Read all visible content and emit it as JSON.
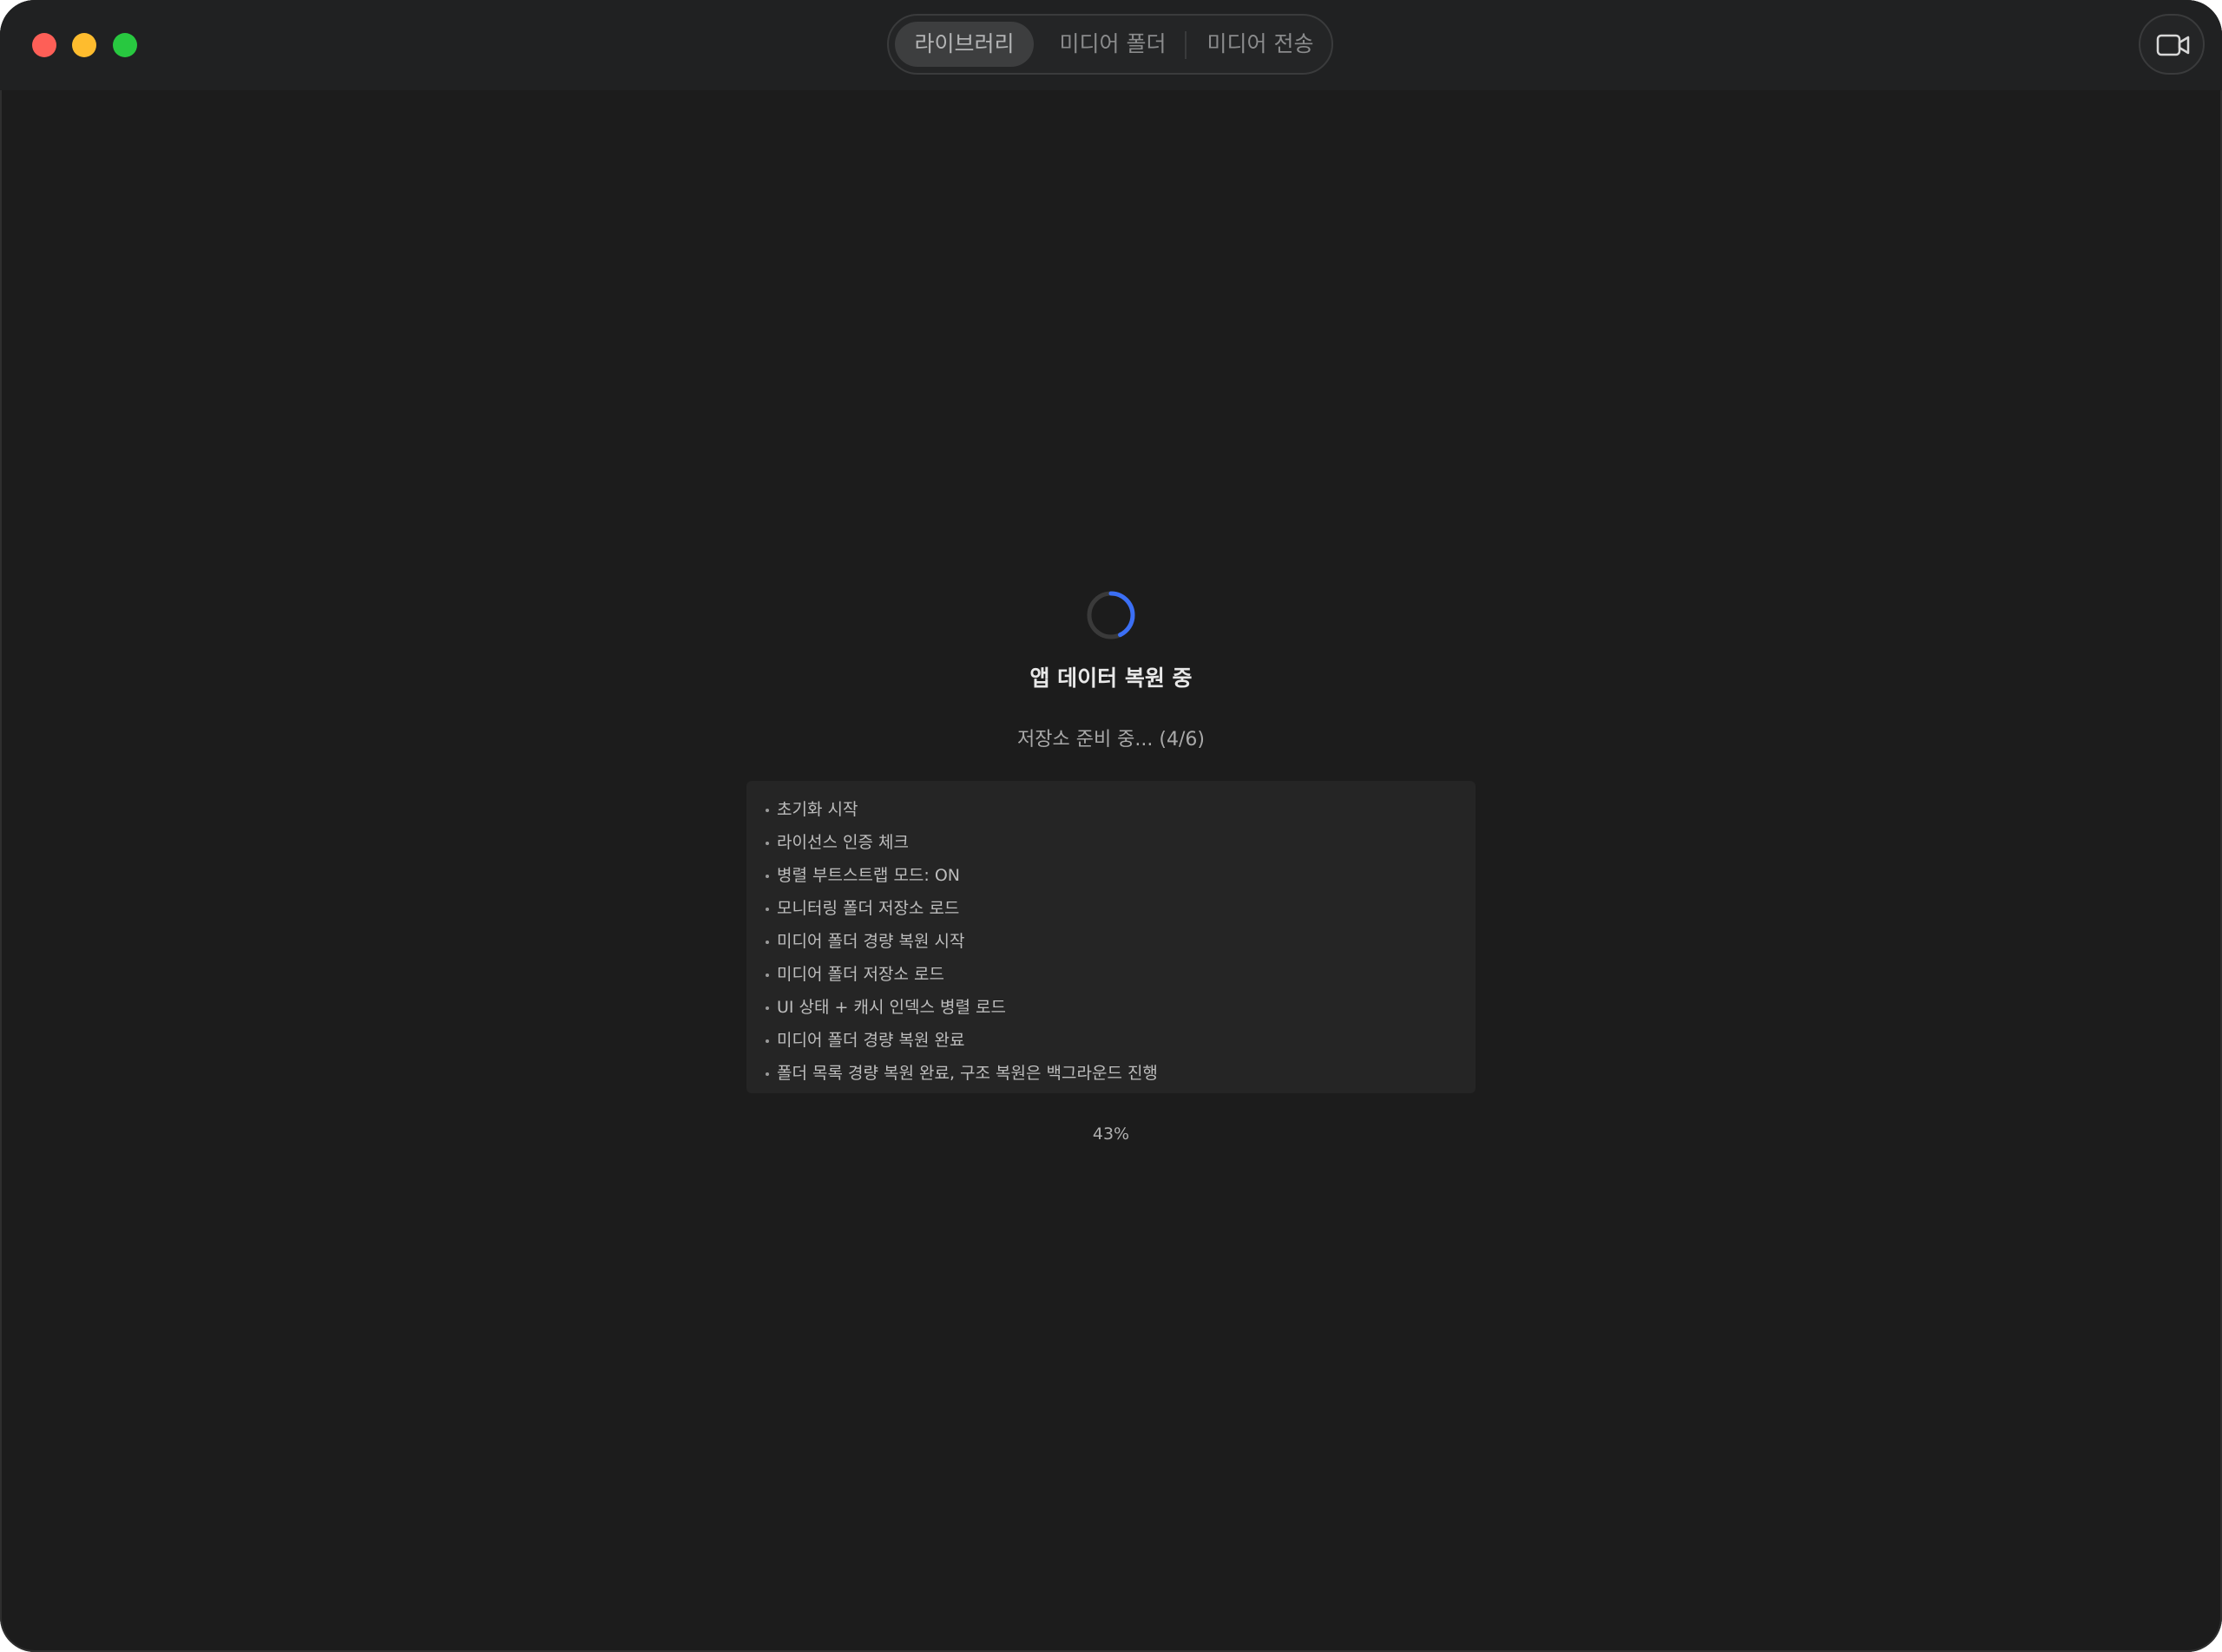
{
  "window": {
    "traffic_lights": [
      "close",
      "minimize",
      "maximize"
    ]
  },
  "tabs": [
    {
      "label": "라이브러리",
      "selected": true
    },
    {
      "label": "미디어 폴더",
      "selected": false
    },
    {
      "label": "미디어 전송",
      "selected": false
    }
  ],
  "toolbar": {
    "video_icon": "video-camera-icon"
  },
  "loading": {
    "title": "앱 데이터 복원 중",
    "status": "저장소 준비 중... (4/6)",
    "percent_label": "43%",
    "progress_fraction": 0.43,
    "spinner_color": "#3b6ff5",
    "log": [
      "초기화 시작",
      "라이선스 인증 체크",
      "병렬 부트스트랩 모드: ON",
      "모니터링 폴더 저장소 로드",
      "미디어 폴더 경량 복원 시작",
      "미디어 폴더 저장소 로드",
      "UI 상태 + 캐시 인덱스 병렬 로드",
      "미디어 폴더 경량 복원 완료",
      "폴더 목록 경량 복원 완료, 구조 복원은 백그라운드 진행"
    ]
  }
}
